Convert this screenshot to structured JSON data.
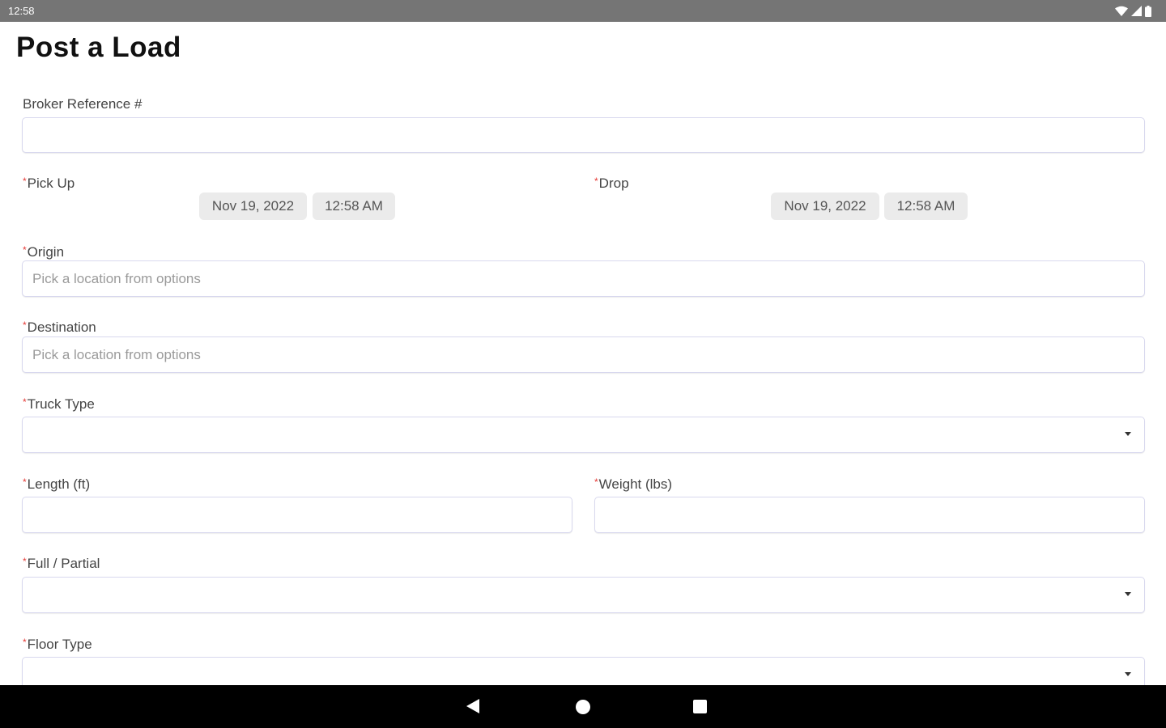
{
  "status_bar": {
    "time": "12:58",
    "icons": [
      "wifi-icon",
      "cellular-signal-icon",
      "battery-icon"
    ]
  },
  "page": {
    "title": "Post a Load"
  },
  "form": {
    "broker_reference": {
      "label": "Broker Reference #",
      "value": ""
    },
    "pick_up": {
      "label": "Pick Up",
      "date": "Nov 19, 2022",
      "time": "12:58 AM"
    },
    "drop": {
      "label": "Drop",
      "date": "Nov 19, 2022",
      "time": "12:58 AM"
    },
    "origin": {
      "label": "Origin",
      "placeholder": "Pick a location from options",
      "value": ""
    },
    "destination": {
      "label": "Destination",
      "placeholder": "Pick a location from options",
      "value": ""
    },
    "truck_type": {
      "label": "Truck Type",
      "value": ""
    },
    "length": {
      "label": "Length (ft)",
      "value": ""
    },
    "weight": {
      "label": "Weight (lbs)",
      "value": ""
    },
    "full_partial": {
      "label": "Full / Partial",
      "value": ""
    },
    "floor_type": {
      "label": "Floor Type",
      "value": ""
    },
    "required_marker": "*"
  },
  "nav_bar": {
    "icons": [
      "back-icon",
      "home-icon",
      "recents-icon"
    ]
  },
  "colors": {
    "status_bar": "#757575",
    "required_marker": "#e53935",
    "field_border": "#d8d8ee",
    "chip_background": "#ebebeb",
    "nav_bar": "#000000"
  }
}
